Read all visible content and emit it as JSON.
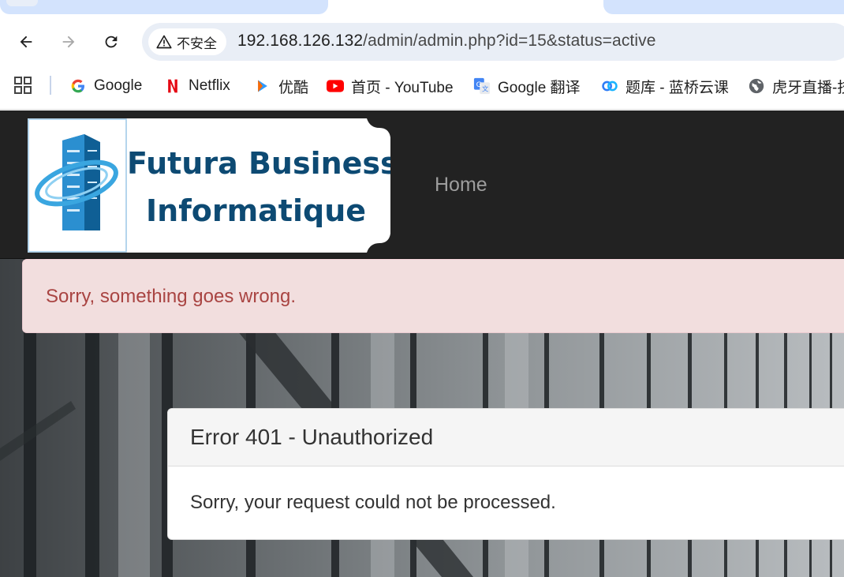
{
  "browser": {
    "security_label": "不安全",
    "url_host": "192.168.126.132",
    "url_path": "/admin/admin.php?id=15&status=active"
  },
  "bookmarks": [
    {
      "label": "Google",
      "icon": "google-icon"
    },
    {
      "label": "Netflix",
      "icon": "netflix-icon"
    },
    {
      "label": "优酷",
      "icon": "youku-icon"
    },
    {
      "label": "首页 - YouTube",
      "icon": "youtube-icon"
    },
    {
      "label": "Google 翻译",
      "icon": "google-translate-icon"
    },
    {
      "label": "题库 - 蓝桥云课",
      "icon": "lanqiao-icon"
    },
    {
      "label": "虎牙直播-技",
      "icon": "globe-icon"
    }
  ],
  "site": {
    "logo_line1": "Futura Business",
    "logo_line2": "Informatique",
    "nav_home": "Home"
  },
  "alert": {
    "message": "Sorry, something goes wrong."
  },
  "panel": {
    "title": "Error 401 - Unauthorized",
    "body": "Sorry, your request could not be processed."
  },
  "colors": {
    "navbar_bg": "#222222",
    "alert_bg": "#f2dede",
    "alert_text": "#a94442",
    "logo_text": "#0d4a73"
  }
}
